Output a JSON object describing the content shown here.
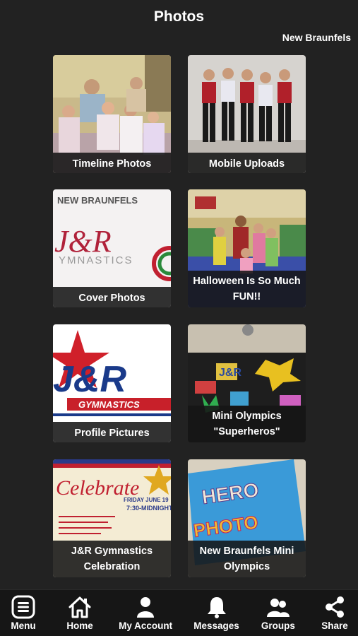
{
  "header": {
    "title": "Photos",
    "location": "New Braunfels"
  },
  "albums": [
    {
      "label": "Timeline Photos"
    },
    {
      "label": "Mobile Uploads"
    },
    {
      "label": "Cover Photos"
    },
    {
      "label": "Halloween Is So Much FUN!!"
    },
    {
      "label": "Profile Pictures"
    },
    {
      "label": "Mini Olympics \"Superheros\""
    },
    {
      "label": "J&R Gymnastics Celebration"
    },
    {
      "label": "New Braunfels Mini Olympics"
    }
  ],
  "photo_text": {
    "cover_top": "NEW BRAUNFELS",
    "cover_logo": "J&R",
    "cover_sub": "YMNASTICS",
    "profile_logo": "J&R",
    "profile_sub": "GYMNASTICS",
    "celebrate": "Celebrate",
    "celebrate_date": "FRIDAY JUNE 19",
    "celebrate_time": "7:30-MIDNIGHT",
    "hero1": "HERO",
    "hero2": "PHOTO",
    "jr_banner": "J&R"
  },
  "nav": [
    {
      "label": "Menu",
      "icon": "menu-icon"
    },
    {
      "label": "Home",
      "icon": "home-icon"
    },
    {
      "label": "My Account",
      "icon": "account-icon"
    },
    {
      "label": "Messages",
      "icon": "bell-icon"
    },
    {
      "label": "Groups",
      "icon": "groups-icon"
    },
    {
      "label": "Share",
      "icon": "share-icon"
    }
  ]
}
